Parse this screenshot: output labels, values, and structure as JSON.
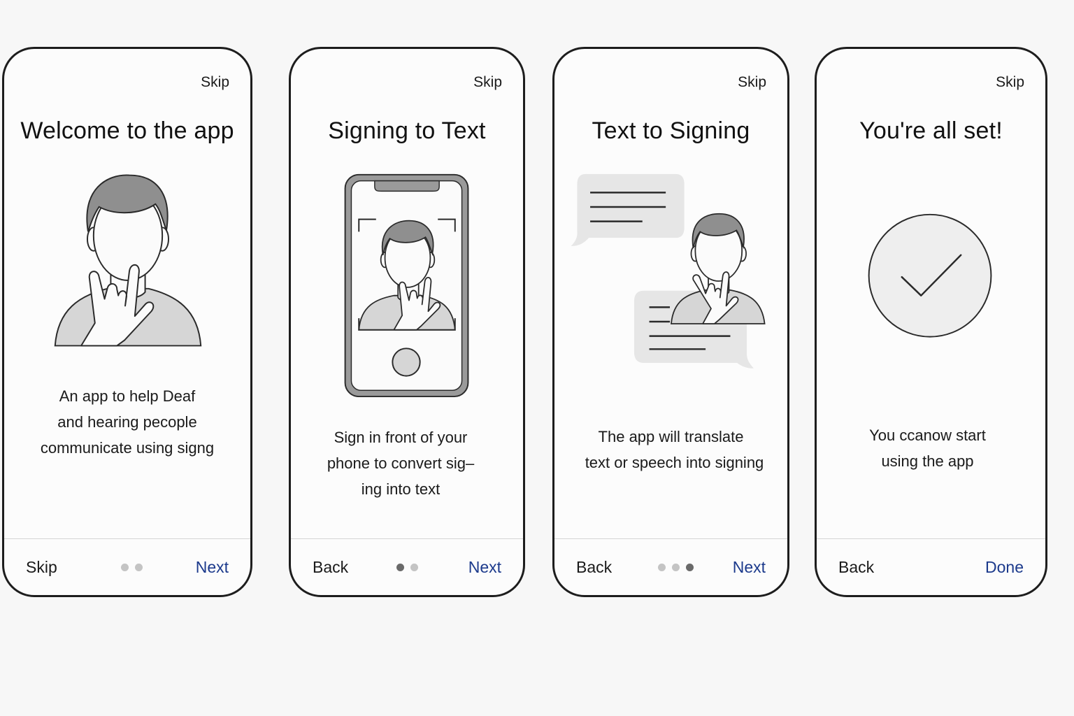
{
  "screens": [
    {
      "skip_label": "Skip",
      "title": "Welcome to the app",
      "description_lines": [
        "An app to help Deaf",
        "and hearing pecople",
        "communicate using signg"
      ],
      "left_label": "Skip",
      "right_label": "Next",
      "dots": 2,
      "active_dot": 0
    },
    {
      "skip_label": "Skip",
      "title": "Signing to Text",
      "description_lines": [
        "Sign in front of your",
        "phone to convert sig–",
        "ing into text"
      ],
      "left_label": "Back",
      "right_label": "Next",
      "dots": 2,
      "active_dot": 0
    },
    {
      "skip_label": "Skip",
      "title": "Text to Signing",
      "description_lines": [
        "The app will translate",
        "text or speech into signing"
      ],
      "left_label": "Back",
      "right_label": "Next",
      "dots": 3,
      "active_dot": 2
    },
    {
      "skip_label": "Skip",
      "title": "You're all set!",
      "description_lines": [
        "You ccanow start",
        "using the app"
      ],
      "left_label": "Back",
      "right_label": "Done",
      "dots": 0,
      "active_dot": -1
    }
  ],
  "colors": {
    "accent_link": "#1c3a8c",
    "hair": "#8f8f8f",
    "shirt": "#d6d6d6",
    "bubble": "#e6e6e6"
  },
  "icons": [
    "person-signing-icon",
    "phone-camera-icon",
    "chat-bubble-icon",
    "checkmark-circle-icon"
  ]
}
